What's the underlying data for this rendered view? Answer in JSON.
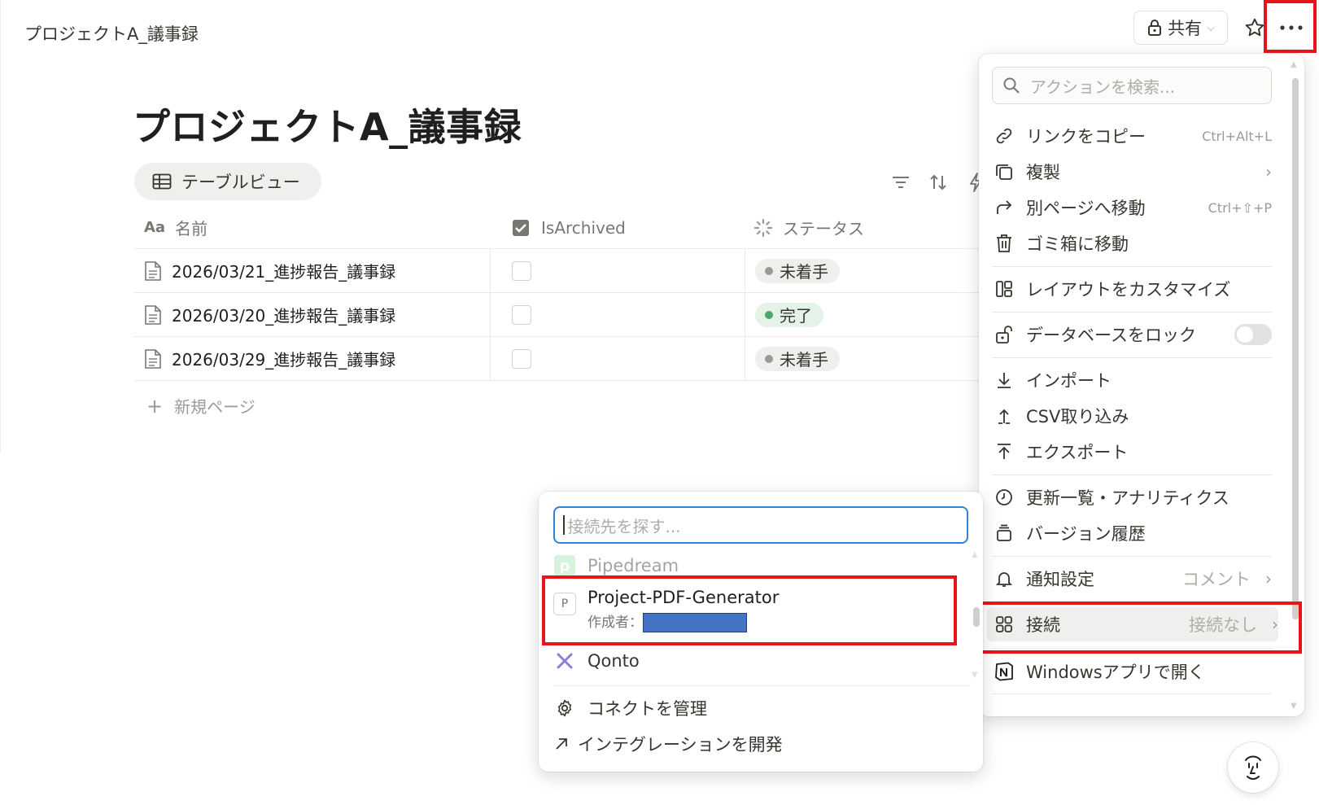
{
  "breadcrumb": "プロジェクトA_議事録",
  "topbar": {
    "share_label": "共有"
  },
  "page": {
    "title": "プロジェクトA_議事録",
    "view_tab": "テーブルビュー"
  },
  "table": {
    "columns": [
      "名前",
      "IsArchived",
      "ステータス"
    ],
    "rows": [
      {
        "name": "2026/03/21_進捗報告_議事録",
        "archived": false,
        "status": "未着手",
        "status_color": "#9b9a97",
        "status_bg": "#efefed"
      },
      {
        "name": "2026/03/20_進捗報告_議事録",
        "archived": false,
        "status": "完了",
        "status_color": "#4aa86b",
        "status_bg": "#e4f2e8"
      },
      {
        "name": "2026/03/29_進捗報告_議事録",
        "archived": false,
        "status": "未着手",
        "status_color": "#9b9a97",
        "status_bg": "#efefed"
      }
    ],
    "new_page": "新規ページ"
  },
  "actions_menu": {
    "search_placeholder": "アクションを検索...",
    "items": {
      "copy_link": {
        "label": "リンクをコピー",
        "shortcut": "Ctrl+Alt+L"
      },
      "duplicate": {
        "label": "複製"
      },
      "move_to": {
        "label": "別ページへ移動",
        "shortcut": "Ctrl+⇧+P"
      },
      "trash": {
        "label": "ゴミ箱に移動"
      },
      "customize_layout": {
        "label": "レイアウトをカスタマイズ"
      },
      "lock_db": {
        "label": "データベースをロック",
        "enabled": false
      },
      "import": {
        "label": "インポート"
      },
      "csv_import": {
        "label": "CSV取り込み"
      },
      "export": {
        "label": "エクスポート"
      },
      "updates": {
        "label": "更新一覧・アナリティクス"
      },
      "version_history": {
        "label": "バージョン履歴"
      },
      "notifications": {
        "label": "通知設定",
        "value": "コメント"
      },
      "connections": {
        "label": "接続",
        "value": "接続なし"
      },
      "open_windows": {
        "label": "Windowsアプリで開く"
      }
    }
  },
  "connect_menu": {
    "search_placeholder": "接続先を探す...",
    "items": {
      "pipedream": {
        "label": "Pipedream"
      },
      "project_pdf": {
        "label": "Project-PDF-Generator",
        "icon_letter": "P",
        "author_label": "作成者："
      },
      "qonto": {
        "label": "Qonto"
      }
    },
    "manage": "コネクトを管理",
    "develop": "インテグレーションを開発"
  },
  "colors": {
    "highlight": "#e8141b",
    "focus": "#2f83d6",
    "redaction": "#4472c4"
  }
}
